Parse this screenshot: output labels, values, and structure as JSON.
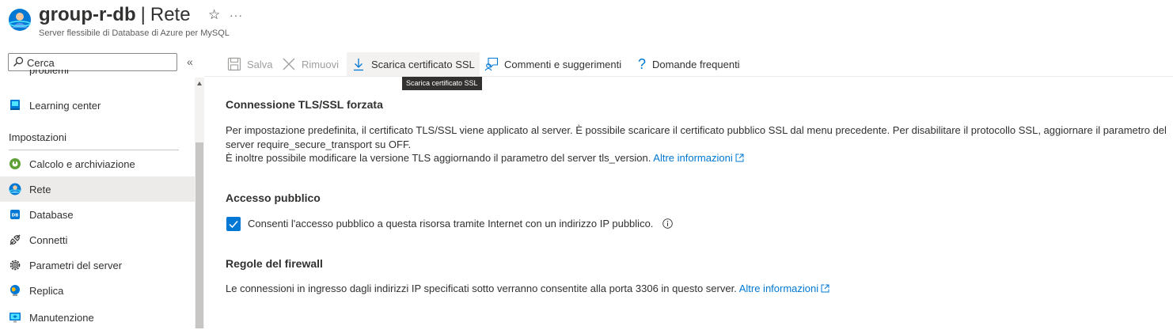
{
  "header": {
    "resource_name": "group-r-db",
    "separator": "|",
    "blade_name": "Rete",
    "star_glyph": "☆",
    "more_glyph": "···",
    "subtitle": "Server flessibile di Database di Azure per MySQL"
  },
  "search": {
    "value": "Cerca"
  },
  "collapse_glyph": "«",
  "sidebar": {
    "partial_item": "problemi",
    "items_top": [
      {
        "label": "Learning center",
        "icon": "learning-center-icon"
      }
    ],
    "section_title": "Impostazioni",
    "items": [
      {
        "label": "Calcolo e archiviazione",
        "icon": "compute-storage-icon"
      },
      {
        "label": "Rete",
        "icon": "network-icon",
        "active": true
      },
      {
        "label": "Database",
        "icon": "database-icon"
      },
      {
        "label": "Connetti",
        "icon": "connect-icon"
      },
      {
        "label": "Parametri del server",
        "icon": "gear-icon"
      },
      {
        "label": "Replica",
        "icon": "replica-icon"
      },
      {
        "label": "Manutenzione",
        "icon": "maintenance-icon"
      }
    ]
  },
  "toolbar": {
    "save_label": "Salva",
    "discard_label": "Rimuovi",
    "download_ssl_label": "Scarica certificato SSL",
    "feedback_label": "Commenti e suggerimenti",
    "faq_label": "Domande frequenti",
    "faq_glyph": "?",
    "tooltip": "Scarica certificato SSL"
  },
  "content": {
    "tls": {
      "title": "Connessione TLS/SSL forzata",
      "line1": "Per impostazione predefinita, il certificato TLS/SSL viene applicato al server. È possibile scaricare il certificato pubblico SSL dal menu precedente. Per disabilitare il protocollo SSL, aggiornare il parametro del",
      "line2": "server require_secure_transport su OFF.",
      "line3": "È inoltre possibile modificare la versione TLS aggiornando il parametro del server tls_version.",
      "link": "Altre informazioni"
    },
    "public_access": {
      "title": "Accesso pubblico",
      "checkbox_label": "Consenti l'accesso pubblico a questa risorsa tramite Internet con un indirizzo IP pubblico.",
      "checked": true
    },
    "firewall": {
      "title": "Regole del firewall",
      "text": "Le connessioni in ingresso dagli indirizzi IP specificati sotto verranno consentite alla porta 3306 in questo server.",
      "link": "Altre informazioni"
    }
  },
  "colors": {
    "accent": "#0078d4",
    "active_item_bg": "#edebe9",
    "tooltip_bg": "#323130",
    "disabled_text": "#a19f9d"
  }
}
